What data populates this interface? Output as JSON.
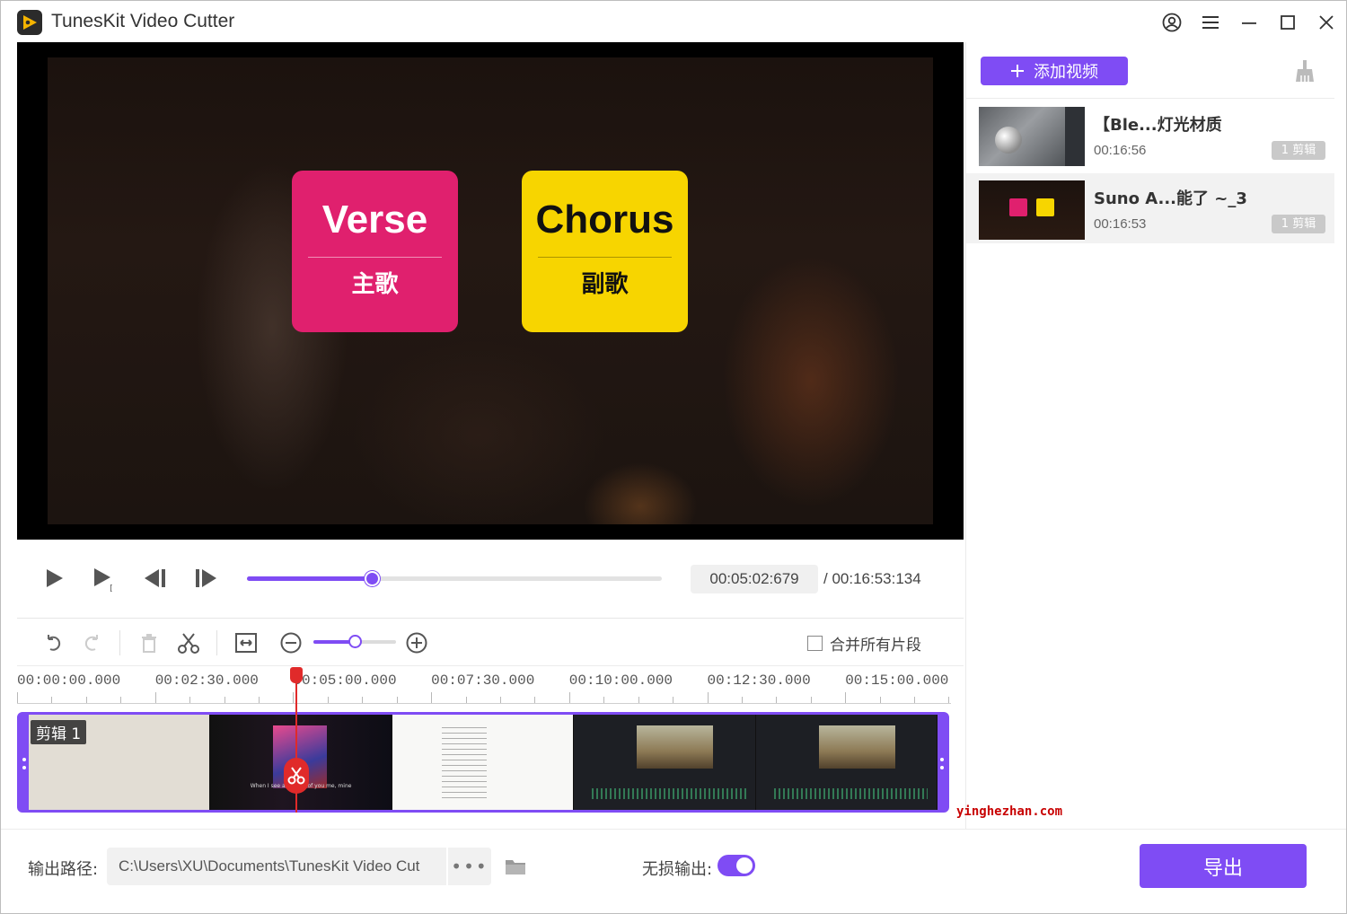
{
  "app": {
    "title": "TunesKit Video Cutter"
  },
  "preview": {
    "cards": [
      {
        "title": "Verse",
        "subtitle": "主歌",
        "color": "#e0206e"
      },
      {
        "title": "Chorus",
        "subtitle": "副歌",
        "color": "#f7d500"
      }
    ]
  },
  "player": {
    "current_time": "00:05:02:679",
    "total_time": "/ 00:16:53:134",
    "progress": 0.3
  },
  "timeline": {
    "merge_label": "合并所有片段",
    "merge_checked": false,
    "zoom_level": 0.5,
    "ruler": [
      "00:00:00.000",
      "00:02:30.000",
      "00:05:00.000",
      "00:07:30.000",
      "00:10:00.000",
      "00:12:30.000",
      "00:15:00.000"
    ],
    "clip_label": "剪辑 1",
    "frame_caption": "When I see a picture of you                 me, mine"
  },
  "sidebar": {
    "add_label": "添加视频",
    "items": [
      {
        "title": "【Ble...灯光材质",
        "duration": "00:16:56",
        "badge": "1 剪辑"
      },
      {
        "title": "Suno A...能了 ~_3",
        "duration": "00:16:53",
        "badge": "1 剪辑"
      }
    ]
  },
  "watermark": "yinghezhan.com",
  "bottom": {
    "output_label": "输出路径:",
    "output_path": "C:\\Users\\XU\\Documents\\TunesKit Video Cut",
    "more_label": "•••",
    "lossless_label": "无损输出:",
    "lossless_on": true,
    "export_label": "导出"
  },
  "colors": {
    "accent": "#7f4cf4",
    "playhead": "#e02a2a"
  },
  "icons": [
    "app-logo-icon",
    "account-icon",
    "menu-icon",
    "minimize-icon",
    "maximize-icon",
    "close-icon",
    "play-icon",
    "play-segment-icon",
    "prev-frame-icon",
    "next-frame-icon",
    "undo-icon",
    "redo-icon",
    "delete-icon",
    "scissors-icon",
    "fit-icon",
    "zoom-out-icon",
    "zoom-in-icon",
    "plus-icon",
    "broom-icon",
    "folder-icon"
  ]
}
